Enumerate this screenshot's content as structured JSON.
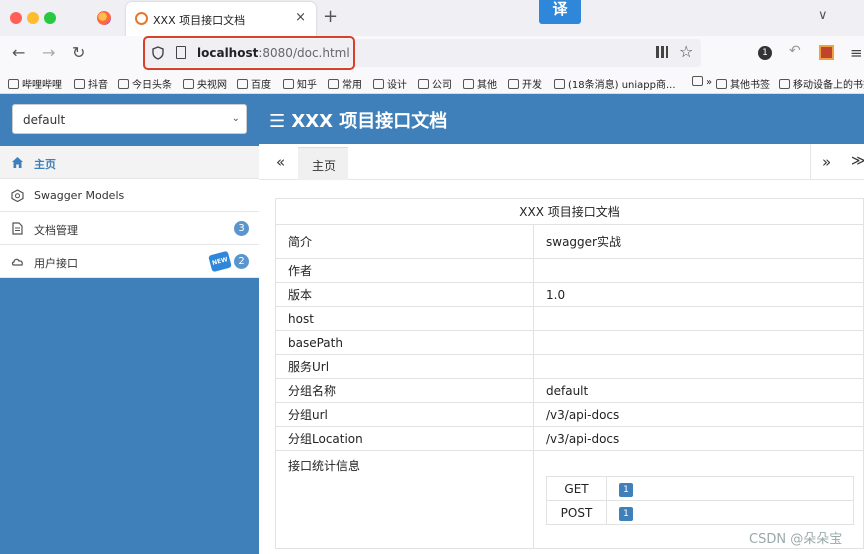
{
  "browser": {
    "tab_title": "XXX 项目接口文档",
    "tab_close": "×",
    "new_tab": "+",
    "tabs_list": "∨",
    "translate": "译",
    "url_host": "localhost",
    "url_rest": ":8080/doc.html",
    "extension_count": "1",
    "bookmarks": [
      "哔哩哔哩",
      "抖音",
      "今日头条",
      "央视网",
      "百度",
      "知乎",
      "常用",
      "设计",
      "公司",
      "其他",
      "开发",
      "(18条消息) uniapp商...",
      "»",
      "其他书签",
      "移动设备上的书签"
    ]
  },
  "app": {
    "group_select": "default",
    "title": "XXX 项目接口文档",
    "menu": [
      {
        "label": "主页",
        "icon": "home-icon"
      },
      {
        "label": "Swagger Models",
        "icon": "models-icon"
      },
      {
        "label": "文档管理",
        "icon": "doc-icon",
        "count": "3"
      },
      {
        "label": "用户接口",
        "icon": "cloud-icon",
        "count": "2",
        "badge": "NEW"
      }
    ],
    "tabs": {
      "left_arrow": "«",
      "home": "主页",
      "right_arrow": "»",
      "more": "≫"
    },
    "info": {
      "caption": "XXX 项目接口文档",
      "rows": [
        {
          "label": "简介",
          "value": "swagger实战"
        },
        {
          "label": "作者",
          "value": ""
        },
        {
          "label": "版本",
          "value": "1.0"
        },
        {
          "label": "host",
          "value": ""
        },
        {
          "label": "basePath",
          "value": ""
        },
        {
          "label": "服务Url",
          "value": ""
        },
        {
          "label": "分组名称",
          "value": "default"
        },
        {
          "label": "分组url",
          "value": "/v3/api-docs"
        },
        {
          "label": "分组Location",
          "value": "/v3/api-docs"
        },
        {
          "label": "接口统计信息",
          "value": ""
        }
      ],
      "methods": [
        {
          "method": "GET",
          "count": "1"
        },
        {
          "method": "POST",
          "count": "1"
        }
      ]
    },
    "watermark": "CSDN @朵朵宝"
  }
}
